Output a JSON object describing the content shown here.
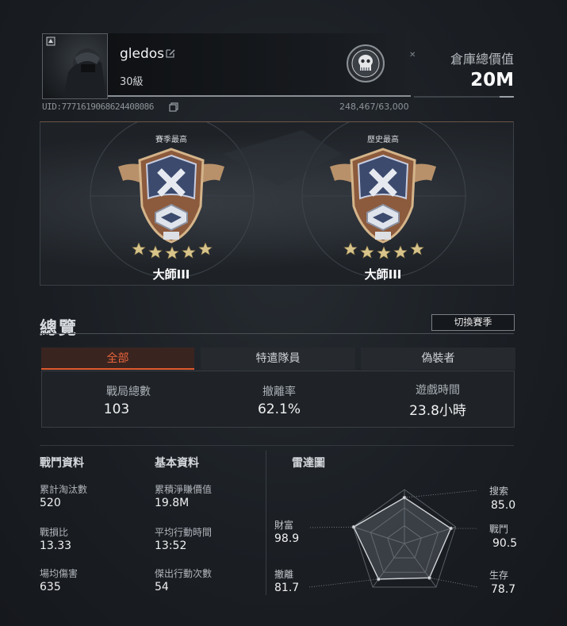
{
  "profile": {
    "username": "gledos",
    "level": "30級",
    "uid": "UID:7771619068624408086",
    "xp": "248,467/63,000"
  },
  "warehouse": {
    "label": "倉庫總價值",
    "value": "20M"
  },
  "rank": {
    "season": {
      "title": "賽季最高",
      "name": "大師III"
    },
    "history": {
      "title": "歷史最高",
      "name": "大師III"
    }
  },
  "overview": {
    "title": "總覽",
    "season_button": "切換賽季",
    "tabs": [
      {
        "label": "全部",
        "active": true
      },
      {
        "label": "特遣隊員",
        "active": false
      },
      {
        "label": "偽裝者",
        "active": false
      }
    ],
    "summary": [
      {
        "label": "戰局總數",
        "value": "103"
      },
      {
        "label": "撤離率",
        "value": "62.1%"
      },
      {
        "label": "遊戲時間",
        "value": "23.8小時"
      }
    ]
  },
  "combat": {
    "title": "戰鬥資料",
    "stats": [
      {
        "label": "累計淘汰數",
        "value": "520"
      },
      {
        "label": "戰損比",
        "value": "13.33"
      },
      {
        "label": "場均傷害",
        "value": "635"
      }
    ]
  },
  "basic": {
    "title": "基本資料",
    "stats": [
      {
        "label": "累積淨賺價值",
        "value": "19.8M"
      },
      {
        "label": "平均行動時間",
        "value": "13:52"
      },
      {
        "label": "傑出行動次數",
        "value": "54"
      }
    ]
  },
  "radar": {
    "title": "雷達圖",
    "axes": [
      {
        "label": "搜索",
        "value": "85.0"
      },
      {
        "label": "戰鬥",
        "value": "90.5"
      },
      {
        "label": "生存",
        "value": "78.7"
      },
      {
        "label": "撤離",
        "value": "81.7"
      },
      {
        "label": "財富",
        "value": "98.9"
      }
    ]
  },
  "colors": {
    "accent": "#e05a2e",
    "star": "#d8c48a"
  }
}
